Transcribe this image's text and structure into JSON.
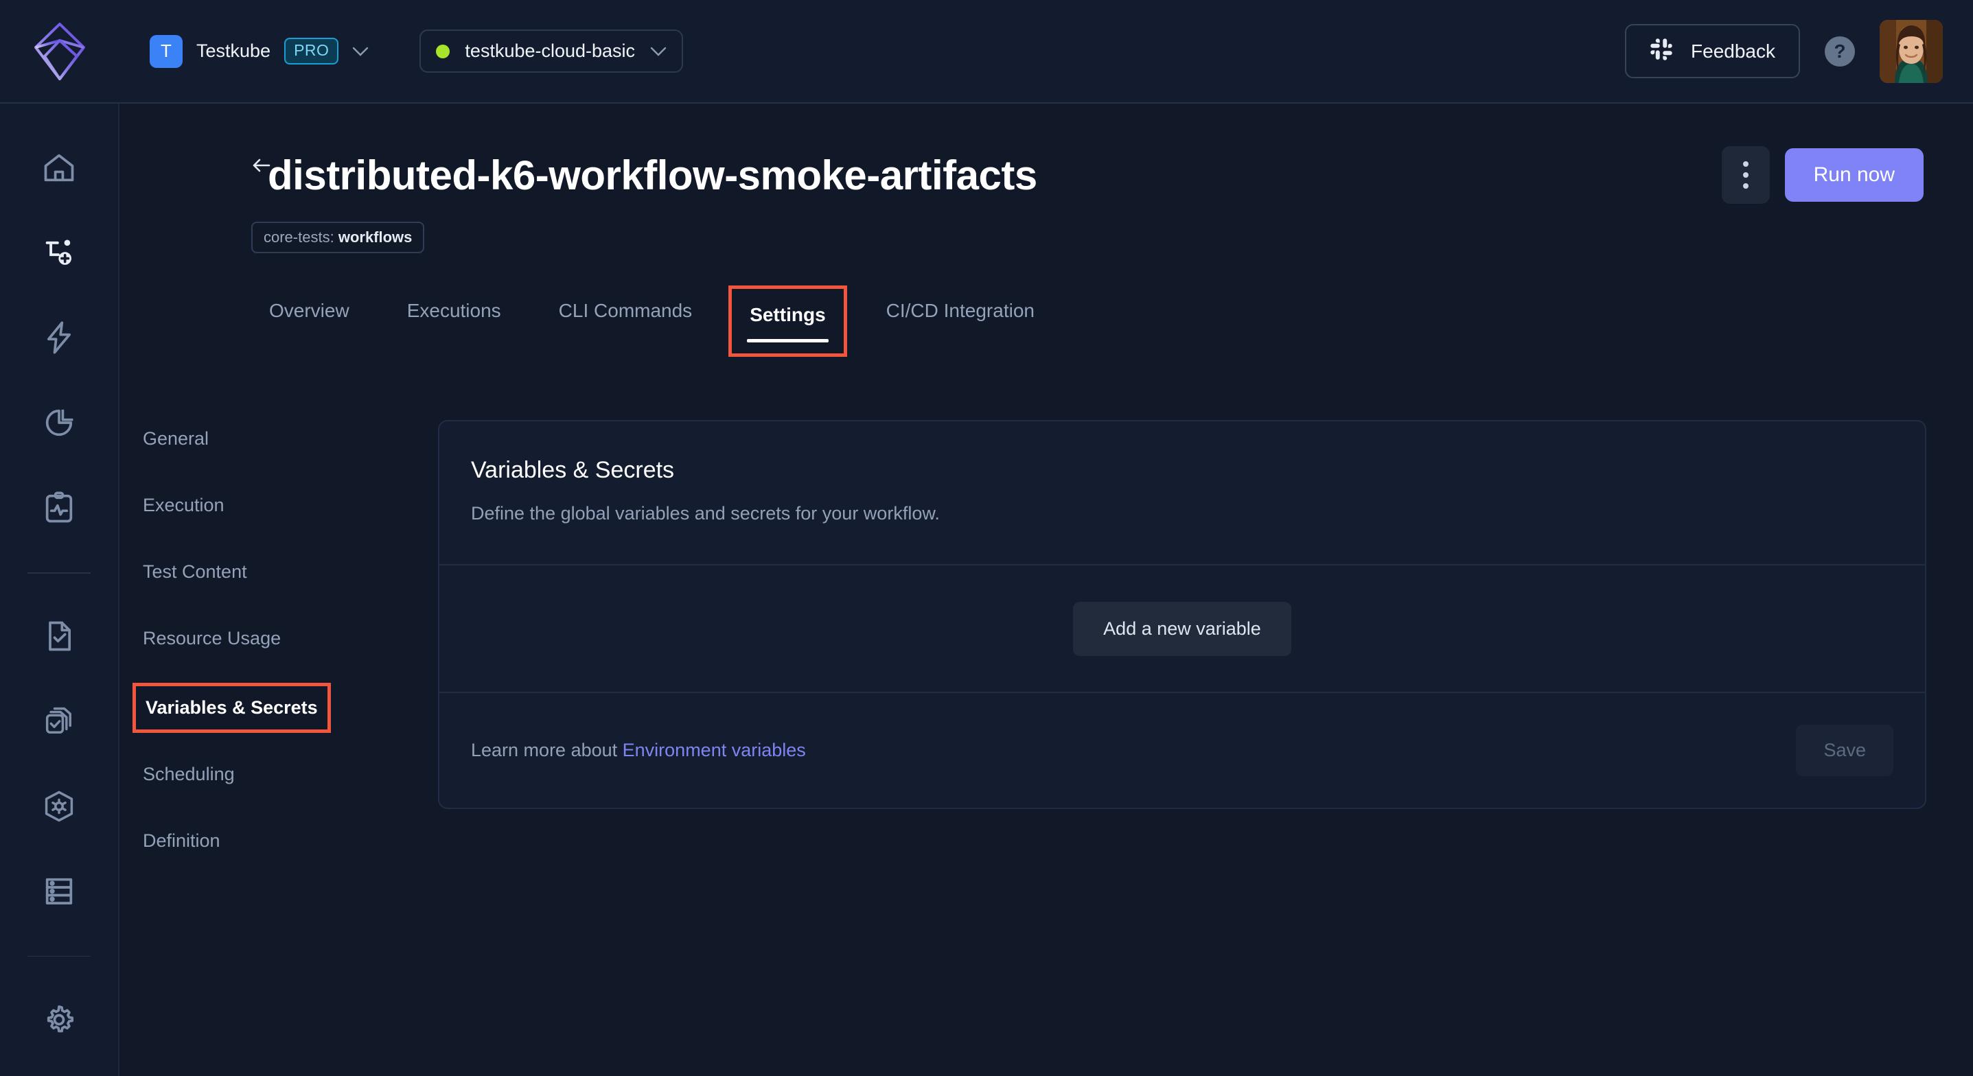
{
  "topbar": {
    "logo_icon": "testkube-cube-logo",
    "org": {
      "avatar_letter": "T",
      "name": "Testkube",
      "plan_badge": "PRO",
      "chevron_icon": "chevron-down-icon"
    },
    "environment": {
      "status_icon": "status-dot-green",
      "name": "testkube-cloud-basic",
      "chevron_icon": "chevron-down-icon",
      "status_color": "#a8e42a"
    },
    "feedback": {
      "icon": "slack-icon",
      "label": "Feedback"
    },
    "help_icon": "question-mark-icon",
    "avatar_icon": "user-avatar"
  },
  "rail": {
    "items": [
      {
        "icon": "home-icon",
        "name": "home"
      },
      {
        "icon": "add-workflow-icon",
        "name": "create-workflow"
      },
      {
        "icon": "lightning-icon",
        "name": "triggers"
      },
      {
        "icon": "pie-chart-icon",
        "name": "dashboard"
      },
      {
        "icon": "clipboard-activity-icon",
        "name": "status-pages"
      },
      {
        "icon": "file-check-icon",
        "name": "test-workflows"
      },
      {
        "icon": "files-stack-icon",
        "name": "test-suites"
      },
      {
        "icon": "shield-gear-icon",
        "name": "webhooks"
      },
      {
        "icon": "server-icon",
        "name": "agents"
      },
      {
        "icon": "gear-icon",
        "name": "settings"
      }
    ]
  },
  "page": {
    "back_icon": "back-arrow-icon",
    "title": "distributed-k6-workflow-smoke-artifacts",
    "tag_prefix": "core-tests:",
    "tag_value": "workflows",
    "kebab_icon": "more-vertical-icon",
    "run_now_label": "Run now",
    "run_now_color": "#8083f5"
  },
  "tabs": [
    {
      "label": "Overview",
      "active": false,
      "annotated": false
    },
    {
      "label": "Executions",
      "active": false,
      "annotated": false
    },
    {
      "label": "CLI Commands",
      "active": false,
      "annotated": false
    },
    {
      "label": "Settings",
      "active": true,
      "annotated": true
    },
    {
      "label": "CI/CD Integration",
      "active": false,
      "annotated": false
    }
  ],
  "subnav": [
    {
      "label": "General",
      "active": false,
      "annotated": false
    },
    {
      "label": "Execution",
      "active": false,
      "annotated": false
    },
    {
      "label": "Test Content",
      "active": false,
      "annotated": false
    },
    {
      "label": "Resource Usage",
      "active": false,
      "annotated": false
    },
    {
      "label": "Variables & Secrets",
      "active": true,
      "annotated": true
    },
    {
      "label": "Scheduling",
      "active": false,
      "annotated": false
    },
    {
      "label": "Definition",
      "active": false,
      "annotated": false
    }
  ],
  "card": {
    "title": "Variables & Secrets",
    "subtitle": "Define the global variables and secrets for your workflow.",
    "add_variable_label": "Add a new variable",
    "footer_text": "Learn more about ",
    "footer_link": "Environment variables",
    "save_label": "Save"
  },
  "annotation_color": "#f4553d"
}
